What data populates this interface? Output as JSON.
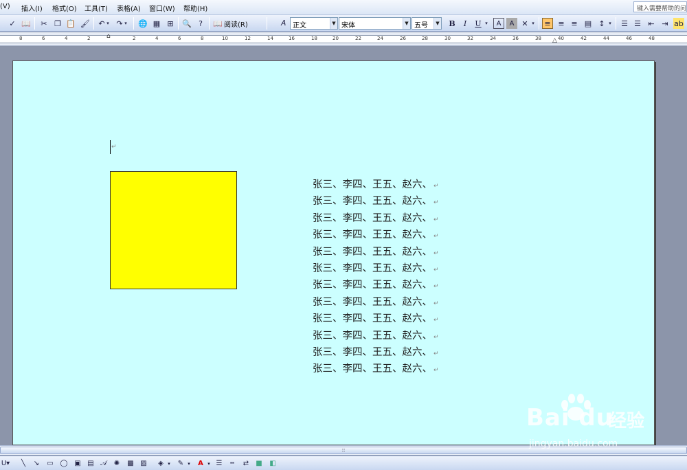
{
  "menu": {
    "items": [
      "(V)",
      "插入(I)",
      "格式(O)",
      "工具(T)",
      "表格(A)",
      "窗口(W)",
      "帮助(H)"
    ],
    "help_placeholder": "键入需要帮助的问题"
  },
  "toolbar": {
    "read_label": "阅读(R)",
    "style_value": "正文",
    "font_value": "宋体",
    "size_value": "五号"
  },
  "ruler": {
    "numbers": [
      "8",
      "6",
      "4",
      "2",
      "2",
      "4",
      "6",
      "8",
      "10",
      "12",
      "14",
      "16",
      "18",
      "20",
      "22",
      "24",
      "26",
      "28",
      "30",
      "32",
      "34",
      "36",
      "38",
      "40",
      "42",
      "44",
      "46",
      "48"
    ]
  },
  "document": {
    "paragraph_mark": "↵",
    "lines": [
      "张三、李四、王五、赵六、",
      "张三、李四、王五、赵六、",
      "张三、李四、王五、赵六、",
      "张三、李四、王五、赵六、",
      "张三、李四、王五、赵六、",
      "张三、李四、王五、赵六、",
      "张三、李四、王五、赵六、",
      "张三、李四、王五、赵六、",
      "张三、李四、王五、赵六、",
      "张三、李四、王五、赵六、",
      "张三、李四、王五、赵六、",
      "张三、李四、王五、赵六、"
    ],
    "shape_fill": "#ffff00",
    "page_color": "#ccffff"
  },
  "watermark": {
    "brand": "Bai  du",
    "brand_cn": "经验",
    "url": "jingyan.baidu.com"
  }
}
